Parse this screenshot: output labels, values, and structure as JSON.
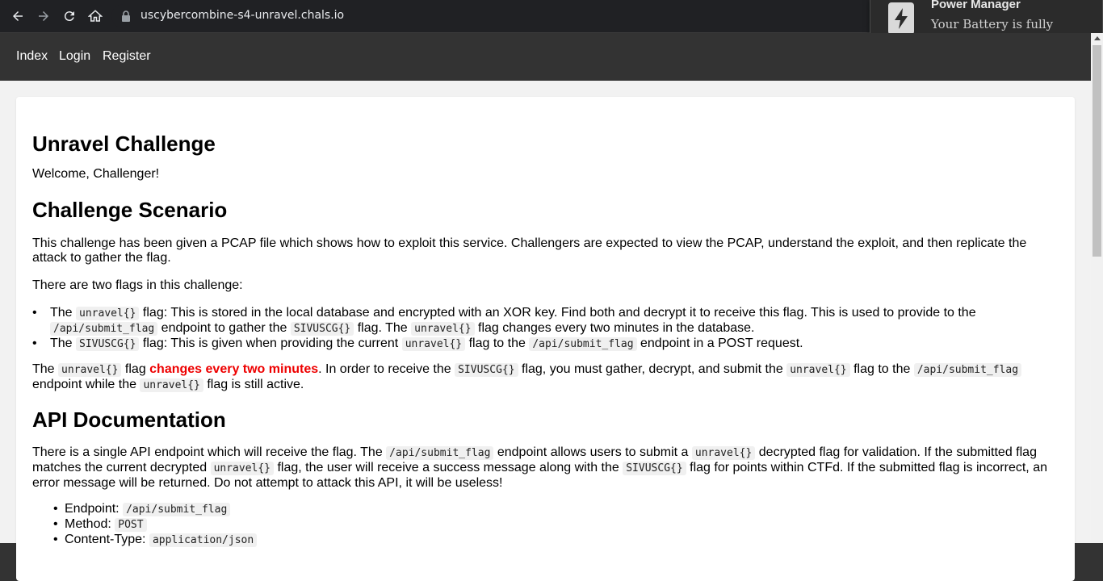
{
  "browser": {
    "url": "uscybercombine-s4-unravel.chals.io"
  },
  "notification": {
    "title": "Power Manager",
    "body": "Your Battery is fully charged"
  },
  "nav": {
    "index": "Index",
    "login": "Login",
    "register": "Register"
  },
  "page": {
    "title": "Unravel Challenge",
    "welcome": "Welcome, Challenger!",
    "scenario_heading": "Challenge Scenario",
    "scenario_text": "This challenge has been given a PCAP file which shows how to exploit this service. Challengers are expected to view the PCAP, understand the exploit, and then replicate the attack to gather the flag.",
    "two_flags": "There are two flags in this challenge:",
    "flag1": {
      "t1": "The ",
      "c1": "unravel{}",
      "t2": " flag: This is stored in the local database and encrypted with an XOR key. Find both and decrypt it to receive this flag. This is used to provide to the ",
      "c2": "/api/submit_flag",
      "t3": " endpoint to gather the ",
      "c3": "SIVUSCG{}",
      "t4": " flag. The ",
      "c4": "unravel{}",
      "t5": " flag changes every two minutes in the database."
    },
    "flag2": {
      "t1": "The ",
      "c1": "SIVUSCG{}",
      "t2": " flag: This is given when providing the current ",
      "c2": "unravel{}",
      "t3": " flag to the ",
      "c3": "/api/submit_flag",
      "t4": " endpoint in a POST request."
    },
    "note": {
      "t1": "The ",
      "c1": "unravel{}",
      "t2": " flag ",
      "red": "changes every two minutes",
      "t3": ". In order to receive the ",
      "c2": "SIVUSCG{}",
      "t4": " flag, you must gather, decrypt, and submit the ",
      "c3": "unravel{}",
      "t5": " flag to the ",
      "c4": "/api/submit_flag",
      "t6": " endpoint while the ",
      "c5": "unravel{}",
      "t7": " flag is still active."
    },
    "api_heading": "API Documentation",
    "api": {
      "t1": "There is a single API endpoint which will receive the flag. The ",
      "c1": "/api/submit_flag",
      "t2": " endpoint allows users to submit a ",
      "c2": "unravel{}",
      "t3": " decrypted flag for validation. If the submitted flag matches the current decrypted ",
      "c3": "unravel{}",
      "t4": " flag, the user will receive a success message along with the ",
      "c4": "SIVUSCG{}",
      "t5": " flag for points within CTFd. If the submitted flag is incorrect, an error message will be returned. Do not attempt to attack this API, it will be useless!"
    },
    "details": {
      "endpoint_label": "Endpoint: ",
      "endpoint_value": "/api/submit_flag",
      "method_label": "Method: ",
      "method_value": "POST",
      "ctype_label": "Content-Type: ",
      "ctype_value": "application/json"
    }
  }
}
